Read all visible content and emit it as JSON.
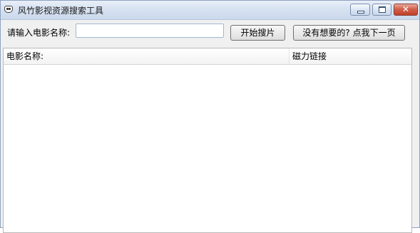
{
  "window": {
    "title": "风竹影视资源搜索工具",
    "app_icon": "owl-icon"
  },
  "titlebar_buttons": {
    "minimize": "minimize-icon",
    "maximize": "maximize-icon",
    "close_glyph": "✕"
  },
  "search": {
    "label": "请输入电影名称:",
    "value": "",
    "placeholder": ""
  },
  "buttons": {
    "start_search": "开始搜片",
    "next_page": "没有想要的? 点我下一页"
  },
  "results": {
    "columns": [
      "电影名称:",
      "磁力链接"
    ],
    "rows": []
  }
}
